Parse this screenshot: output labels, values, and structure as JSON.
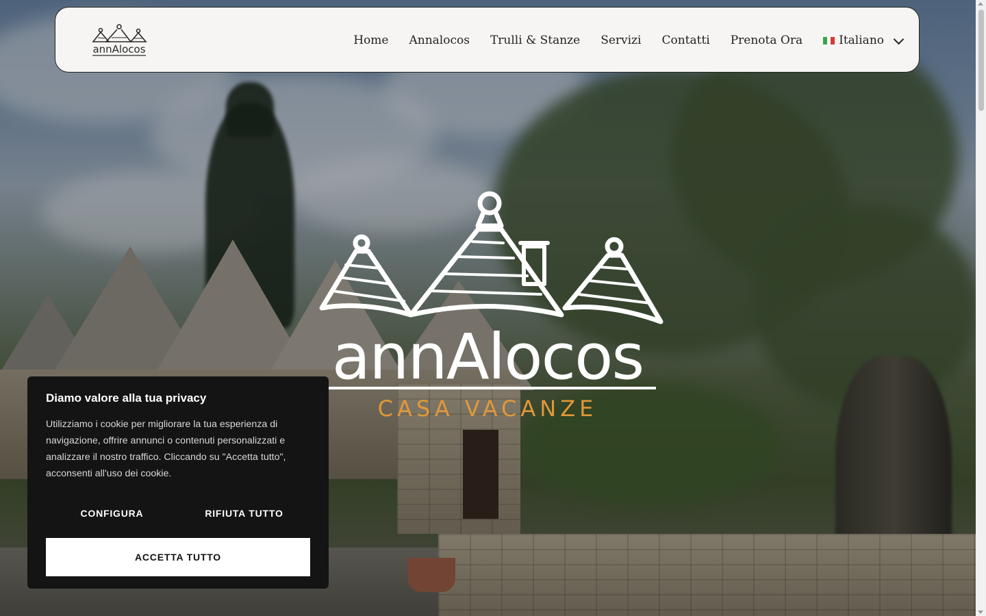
{
  "header": {
    "logo_alt": "annAlocos",
    "nav": [
      "Home",
      "Annalocos",
      "Trulli & Stanze",
      "Servizi",
      "Contatti",
      "Prenota Ora"
    ],
    "language": "Italiano",
    "flag_colors": [
      "#3aa34a",
      "#ffffff",
      "#d63a37"
    ]
  },
  "hero": {
    "brand": "annAlocos",
    "tagline": "CASA VACANZE",
    "brand_color": "#ffffff",
    "tagline_color": "#e0983a"
  },
  "cookie": {
    "title": "Diamo valore alla tua privacy",
    "text": "Utilizziamo i cookie per migliorare la tua esperienza di navigazione, offrire annunci o contenuti personalizzati e analizzare il nostro traffico. Cliccando su \"Accetta tutto\", acconsenti all'uso dei cookie.",
    "configure_label": "CONFIGURA",
    "reject_label": "RIFIUTA TUTTO",
    "accept_label": "ACCETTA TUTTO"
  }
}
